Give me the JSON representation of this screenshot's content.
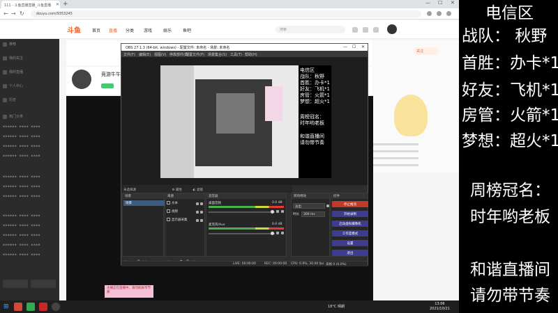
{
  "browser": {
    "tab_title": "111 - 斗鱼直播直播_斗鱼直播",
    "new_tab": "+",
    "url": "douyu.com/9353245",
    "window_controls": [
      "—",
      "☐",
      "✕"
    ]
  },
  "site": {
    "logo": "斗鱼",
    "nav": [
      "首页",
      "直播",
      "分类",
      "游戏",
      "娱乐",
      "鱼吧"
    ],
    "search_placeholder": "搜索",
    "room_title": "竞游牛牛、不",
    "follow_label": "关注"
  },
  "sidebar": {
    "items": [
      "推荐",
      "我的关注",
      "我的直播",
      "个人中心",
      "历史",
      "热门分类"
    ]
  },
  "obs": {
    "title": "OBS 27.1.3 (64-bit, windows) - 配置文件: 未命名 - 场景: 未命名",
    "menu": [
      "文件(F)",
      "编辑(E)",
      "视图(V)",
      "停靠部件(D)",
      "配置文件(P)",
      "场景集合(S)",
      "工具(T)",
      "帮助(H)"
    ],
    "dock_header_left": "未选择源",
    "dock_header_props": "属性",
    "dock_header_filters": "滤镜",
    "panels": {
      "scenes": "场景",
      "sources": "来源",
      "mixer": "混音器",
      "transitions": "转场特效",
      "controls": "控件"
    },
    "scene_item": "场景",
    "sources": [
      "文本",
      "视频",
      "显示器采集"
    ],
    "mixer": [
      {
        "name": "桌面音频",
        "db": "0.0 dB"
      },
      {
        "name": "麦克风/Aux",
        "db": "0.0 dB"
      }
    ],
    "transition": {
      "type": "淡出",
      "duration_label": "时长",
      "duration": "300 ms"
    },
    "controls": [
      "停止推流",
      "开始录制",
      "启动虚拟摄像机",
      "工作室模式",
      "设置",
      "退出"
    ],
    "status": {
      "live": "LIVE: 00:00:00",
      "rec": "REC: 00:00:00",
      "cpu": "CPU: 6.9%, 30.00 fps",
      "dropped": "丢帧 0 (0.0%)"
    },
    "preview_overlay": [
      "电信区",
      "战队：秋野",
      "首胜：办卡*1",
      "好友：飞机*1",
      "房管：火箭*1",
      "梦想：超火*1",
      "周榜冠名：",
      "时年哟老板",
      "和谐直播间",
      "请勿带节奏"
    ]
  },
  "toast": "主播正在直播中，请勿刷屏带节奏",
  "taskbar": {
    "weather": "18°C  晴朗",
    "clock_time": "13:06",
    "clock_date": "2021/10/21"
  },
  "overlay": {
    "line1": "电信区",
    "line2": "战队： 秋野",
    "line3": "首胜：办卡*1",
    "line4": "好友：飞机*1",
    "line5": "房管：火箭*1",
    "line6": "梦想：超火*1",
    "line7": "周榜冠名：",
    "line8": "时年哟老板",
    "line9": "和谐直播间",
    "line10": "请勿带节奏"
  },
  "colors": {
    "brand": "#ff5d23",
    "overlay_bg": "#000000",
    "overlay_text": "#ffffff",
    "obs_control": "#3d3d8f",
    "obs_stop": "#c0392b"
  }
}
